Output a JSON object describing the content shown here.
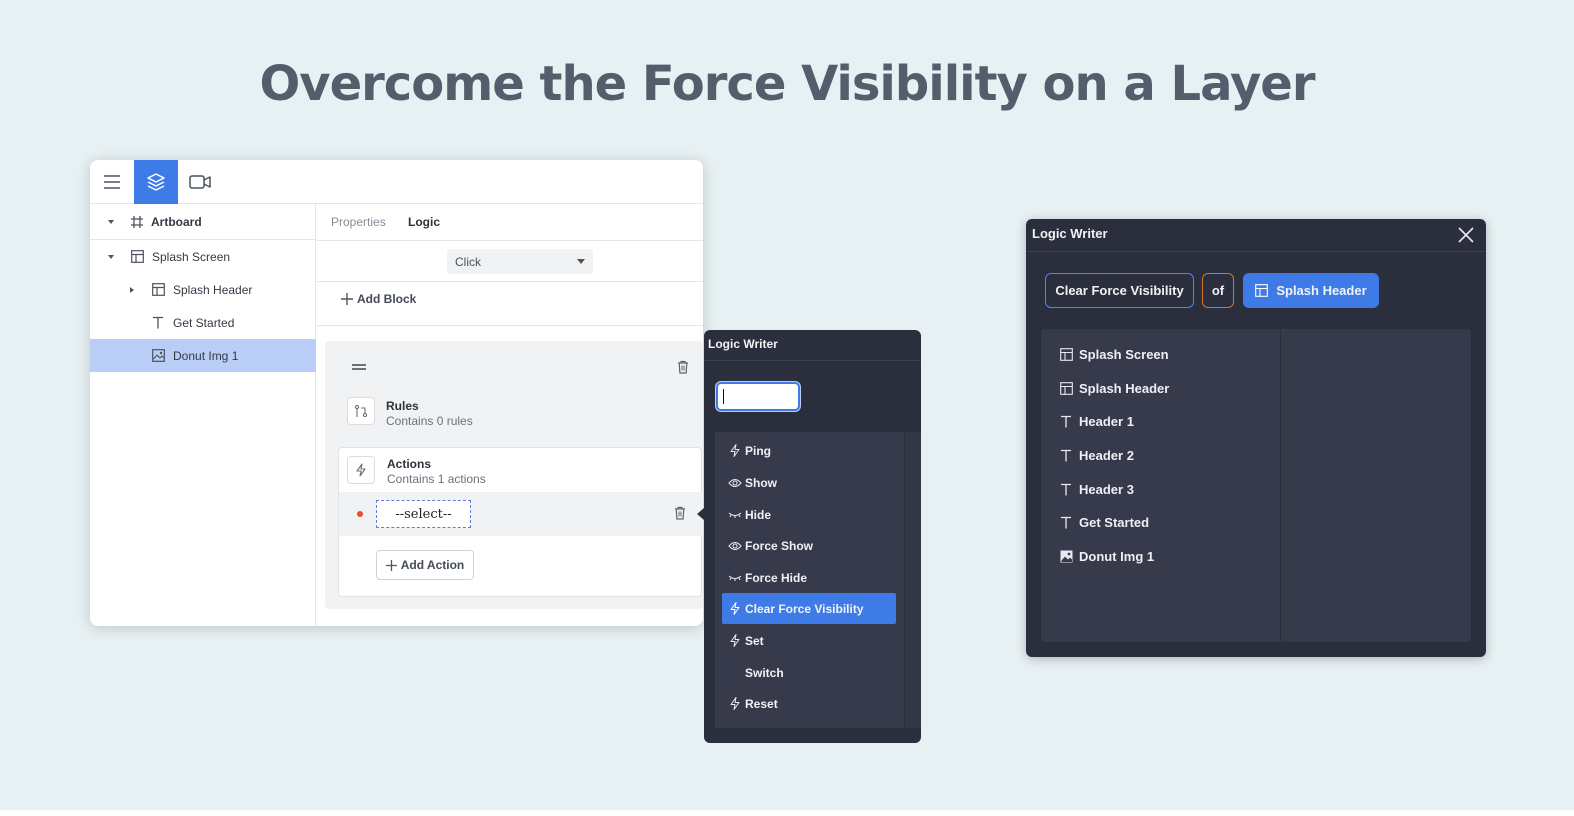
{
  "page": {
    "title": "Overcome the Force Visibility on a Layer"
  },
  "toolbar": {
    "menu_icon": "hamburger-icon",
    "layers_icon": "layers-icon",
    "video_icon": "video-camera-icon"
  },
  "layers": {
    "root": "Artboard",
    "items": [
      {
        "label": "Splash Screen",
        "icon": "frame-icon"
      },
      {
        "label": "Splash Header",
        "icon": "frame-icon"
      },
      {
        "label": "Get Started",
        "icon": "text-icon"
      },
      {
        "label": "Donut Img 1",
        "icon": "image-icon"
      }
    ]
  },
  "panel": {
    "tabs": [
      "Properties",
      "Logic"
    ],
    "trigger": "Click",
    "add_block_label": "Add Block",
    "rules": {
      "title": "Rules",
      "subtitle": "Contains 0 rules"
    },
    "actions": {
      "title": "Actions",
      "subtitle": "Contains 1 actions"
    },
    "action_select": "--select--",
    "add_action_label": "Add Action"
  },
  "dropdown": {
    "title": "Logic Writer",
    "search_value": "",
    "items": [
      {
        "label": "Ping",
        "icon": "bolt-icon"
      },
      {
        "label": "Show",
        "icon": "eye-icon"
      },
      {
        "label": "Hide",
        "icon": "eye-closed-icon"
      },
      {
        "label": "Force Show",
        "icon": "eye-icon"
      },
      {
        "label": "Force Hide",
        "icon": "eye-closed-icon"
      },
      {
        "label": "Clear Force Visibility",
        "icon": "bolt-icon"
      },
      {
        "label": "Set",
        "icon": "bolt-icon"
      },
      {
        "label": "Switch",
        "icon": ""
      },
      {
        "label": "Reset",
        "icon": "bolt-icon"
      }
    ],
    "selected": "Clear Force Visibility"
  },
  "logic_writer": {
    "title": "Logic Writer",
    "verb": "Clear Force Visibility",
    "connector": "of",
    "target": "Splash Header",
    "items": [
      {
        "label": "Splash Screen",
        "icon": "frame-icon"
      },
      {
        "label": "Splash Header",
        "icon": "frame-icon"
      },
      {
        "label": "Header 1",
        "icon": "text-icon"
      },
      {
        "label": "Header 2",
        "icon": "text-icon"
      },
      {
        "label": "Header 3",
        "icon": "text-icon"
      },
      {
        "label": "Get Started",
        "icon": "text-icon"
      },
      {
        "label": "Donut Img 1",
        "icon": "image-icon"
      }
    ]
  },
  "colors": {
    "background": "#e7f1f3",
    "accent": "#3f7be6",
    "dark_panel": "#2b2e3c",
    "connector_border": "#d1772c",
    "title_text": "#535d6c"
  }
}
